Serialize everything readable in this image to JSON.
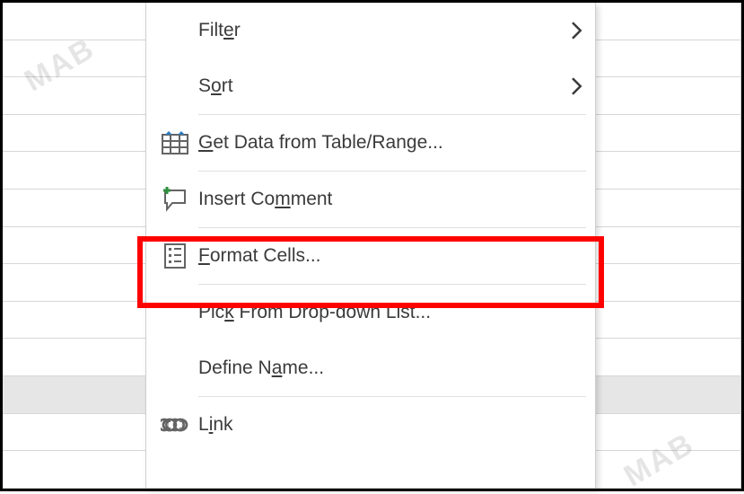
{
  "watermark": "MAB",
  "menu": {
    "filter": {
      "pre": "Filt",
      "u": "e",
      "post": "r",
      "has_sub": true
    },
    "sort": {
      "pre": "S",
      "u": "o",
      "post": "rt",
      "has_sub": true
    },
    "get_data": {
      "pre": "",
      "u": "G",
      "post": "et Data from Table/Range..."
    },
    "insert_comment": {
      "pre": "Insert Co",
      "u": "m",
      "post": "ment"
    },
    "format_cells": {
      "pre": "",
      "u": "F",
      "post": "ormat Cells..."
    },
    "pick_list": {
      "pre": "Pic",
      "u": "k",
      "post": " From Drop-down List..."
    },
    "define_name": {
      "pre": "Define N",
      "u": "a",
      "post": "me..."
    },
    "link": {
      "pre": "L",
      "u": "i",
      "post": "nk"
    }
  }
}
